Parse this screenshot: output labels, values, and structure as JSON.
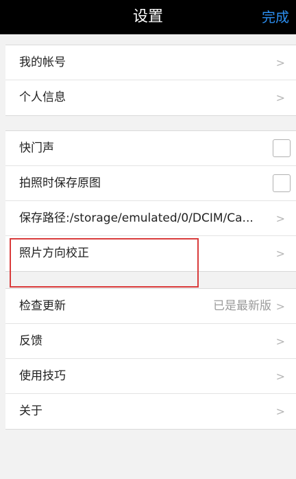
{
  "nav": {
    "title": "设置",
    "done_label": "完成"
  },
  "groups": [
    {
      "items": [
        {
          "label": "我的帐号"
        },
        {
          "label": "个人信息"
        }
      ]
    },
    {
      "items": [
        {
          "label": "快门声",
          "checked": false
        },
        {
          "label": "拍照时保存原图",
          "checked": false
        },
        {
          "label": "保存路径:/storage/emulated/0/DCIM/Ca..."
        },
        {
          "label": "照片方向校正"
        }
      ]
    },
    {
      "items": [
        {
          "label": "检查更新",
          "status": "已是最新版"
        },
        {
          "label": "反馈"
        },
        {
          "label": "使用技巧"
        },
        {
          "label": "关于"
        }
      ]
    }
  ],
  "icons": {
    "chevron": "chevron-right-icon",
    "checkbox": "checkbox-unchecked"
  },
  "colors": {
    "nav_bg": "#000000",
    "accent": "#2b8ef0",
    "highlight": "#d93a3a"
  }
}
